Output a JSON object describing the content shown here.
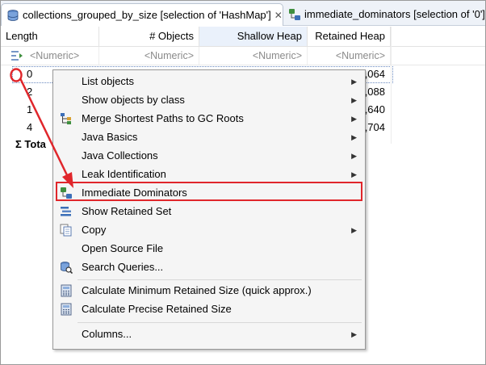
{
  "tabs": [
    {
      "label": "collections_grouped_by_size [selection of 'HashMap']",
      "close": "✕",
      "icon": "database-icon"
    },
    {
      "label": "immediate_dominators [selection of '0']",
      "icon": "dominators-icon"
    }
  ],
  "columns": {
    "length": "Length",
    "objects": "# Objects",
    "shallow": "Shallow Heap",
    "retained": "Retained Heap"
  },
  "filter": {
    "length": "<Numeric>",
    "objects": "<Numeric>",
    "shallow": "<Numeric>",
    "retained": "<Numeric>"
  },
  "rows": [
    {
      "length": "0",
      "retained": ",064"
    },
    {
      "length": "2",
      "retained": ",088"
    },
    {
      "length": "1",
      "retained": ",640"
    },
    {
      "length": "4",
      "retained": ",704"
    }
  ],
  "total_label": "Σ Tota",
  "badge_number": "0",
  "menu": {
    "items": [
      {
        "label": "List objects",
        "submenu": true
      },
      {
        "label": "Show objects by class",
        "submenu": true
      },
      {
        "label": "Merge Shortest Paths to GC Roots",
        "submenu": true
      },
      {
        "label": "Java Basics",
        "submenu": true
      },
      {
        "label": "Java Collections",
        "submenu": true
      },
      {
        "label": "Leak Identification",
        "submenu": true
      },
      {
        "label": "Immediate Dominators",
        "submenu": false
      },
      {
        "label": "Show Retained Set",
        "submenu": false
      },
      {
        "label": "Copy",
        "submenu": true
      },
      {
        "label": "Open Source File",
        "submenu": false
      },
      {
        "label": "Search Queries...",
        "submenu": false
      },
      {
        "label": "Calculate Minimum Retained Size (quick approx.)",
        "submenu": false
      },
      {
        "label": "Calculate Precise Retained Size",
        "submenu": false
      },
      {
        "label": "Columns...",
        "submenu": true
      }
    ],
    "arrow": "▶"
  },
  "colors": {
    "highlight": "#e0262b",
    "menu_bg": "#f5f5f5"
  }
}
